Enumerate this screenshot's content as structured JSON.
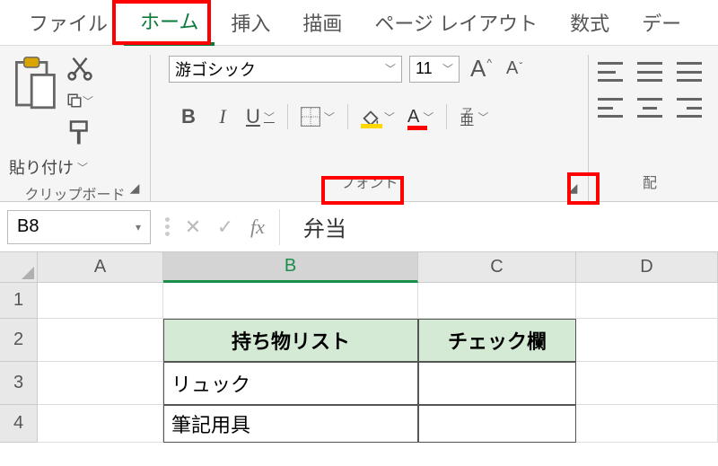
{
  "tabs": {
    "file": "ファイル",
    "home": "ホーム",
    "insert": "挿入",
    "draw": "描画",
    "pagelayout": "ページ レイアウト",
    "formulas": "数式",
    "data_partial": "デー"
  },
  "clipboard": {
    "paste": "貼り付け",
    "group_label": "クリップボード"
  },
  "font": {
    "name": "游ゴシック",
    "size": "11",
    "group_label": "フォント",
    "bold": "B",
    "italic": "I",
    "underline": "U",
    "fontcolor": "A",
    "ruby_top": "ア",
    "ruby_bot": "亜"
  },
  "align": {
    "group_label": "配"
  },
  "namebox": "B8",
  "formula_value": "弁当",
  "cols": {
    "a": "A",
    "b": "B",
    "c": "C",
    "d": "D"
  },
  "rows": {
    "r1": "1",
    "r2": "2",
    "r3": "3",
    "r4": "4"
  },
  "table": {
    "header_b": "持ち物リスト",
    "header_c": "チェック欄",
    "b3": "リュック",
    "b4": "筆記用具"
  }
}
